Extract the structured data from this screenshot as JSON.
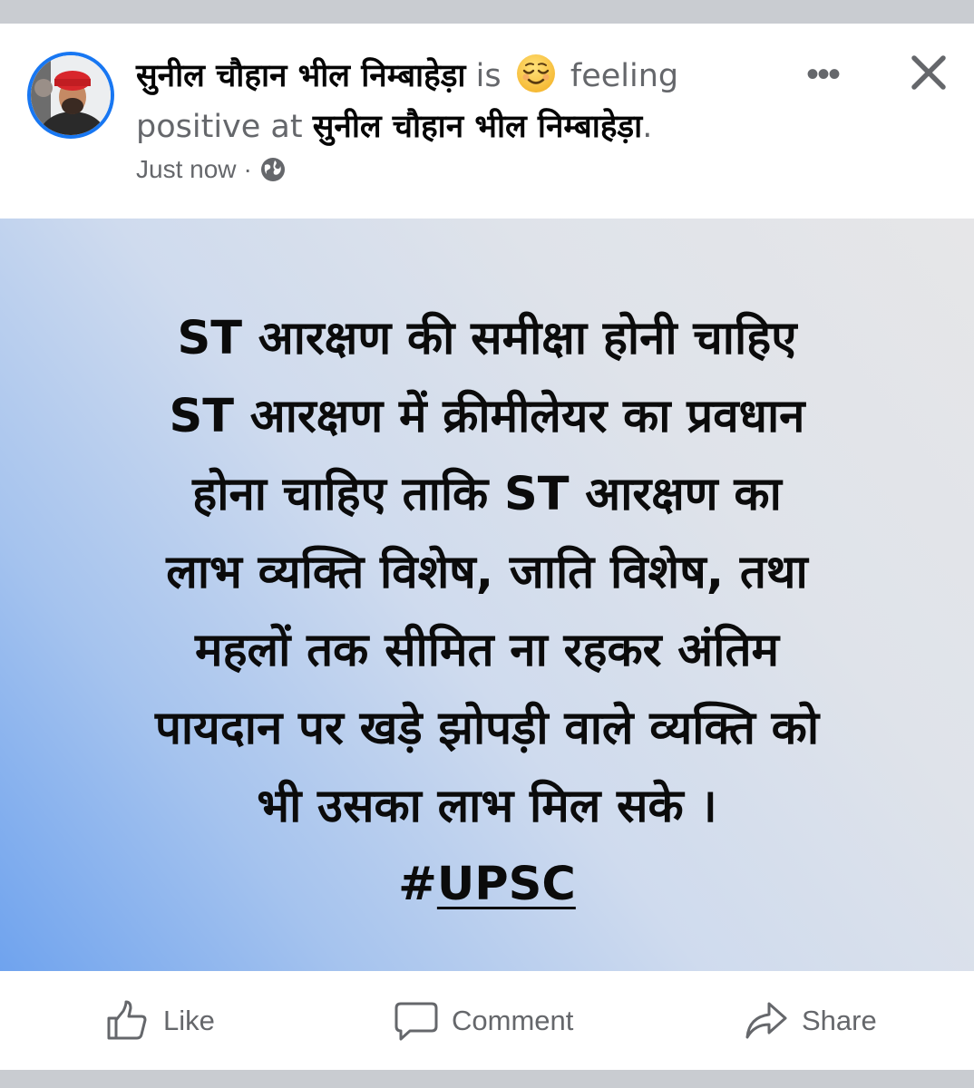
{
  "post": {
    "author": "सुनील चौहान भील निम्बाहेड़ा",
    "is_text": "is",
    "feeling_icon": "relieved-face-emoji",
    "feeling_text": "feeling positive at",
    "location": "सुनील चौहान भील निम्बाहेड़ा",
    "location_suffix": ".",
    "timestamp": "Just now",
    "separator": "·",
    "audience_icon": "globe-icon",
    "more_icon": "•••",
    "close_icon": "close-icon",
    "body_lines": [
      "ST आरक्षण की समीक्षा होनी चाहिए",
      "ST आरक्षण में क्रीमीलेयर का प्रवधान",
      "होना चाहिए ताकि ST आरक्षण का",
      "लाभ व्यक्ति विशेष, जाति विशेष, तथा",
      "महलों तक सीमित ना रहकर अंतिम",
      "पायदान पर खड़े झोपड़ी वाले व्यक्ति को",
      "भी उसका लाभ मिल सके ।"
    ],
    "hashtag_prefix": "#",
    "hashtag": "UPSC",
    "background_colors": [
      "#6fa3ee",
      "#e6e6e8"
    ]
  },
  "actions": {
    "like": "Like",
    "comment": "Comment",
    "share": "Share"
  }
}
